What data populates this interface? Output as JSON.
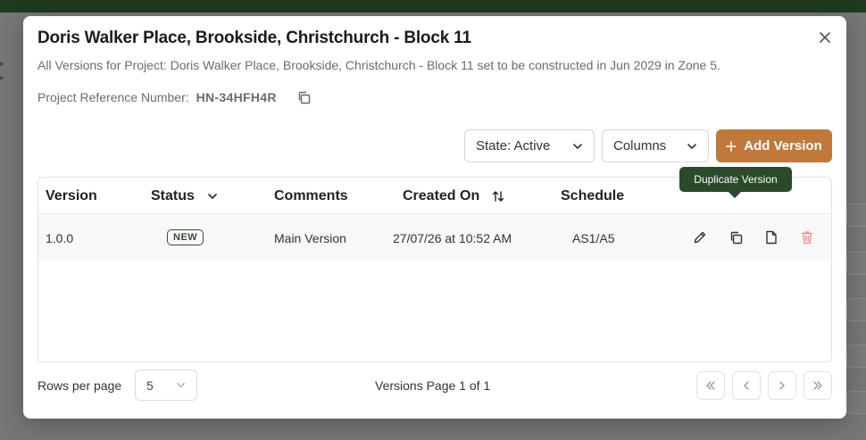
{
  "background": {
    "title_fragment": "t"
  },
  "modal": {
    "title": "Doris Walker Place, Brookside, Christchurch - Block 11",
    "subtitle": "All Versions for Project: Doris Walker Place, Brookside, Christchurch - Block 11 set to be constructed in Jun 2029 in Zone 5.",
    "reference_label": "Project Reference Number:",
    "reference_value": "HN-34HFH4R",
    "icons": {
      "close": "close-icon",
      "copy": "copy-icon"
    }
  },
  "toolbar": {
    "state_label": "State: Active",
    "columns_label": "Columns",
    "add_label": "Add Version"
  },
  "table": {
    "headers": {
      "version": "Version",
      "status": "Status",
      "comments": "Comments",
      "created_on": "Created On",
      "schedule": "Schedule"
    },
    "rows": [
      {
        "version": "1.0.0",
        "status": "NEW",
        "comments": "Main Version",
        "created_on": "27/07/26 at 10:52 AM",
        "schedule": "AS1/A5"
      }
    ],
    "tooltip": "Duplicate Version",
    "colors": {
      "delete": "#f08a8a",
      "accent": "#c0793a",
      "tooltip_bg": "#2a4a2b"
    }
  },
  "footer": {
    "rows_per_page_label": "Rows per page",
    "rows_per_page_value": "5",
    "page_info": "Versions Page 1 of 1",
    "pager_icons": [
      "first-page-icon",
      "prev-page-icon",
      "next-page-icon",
      "last-page-icon"
    ]
  }
}
